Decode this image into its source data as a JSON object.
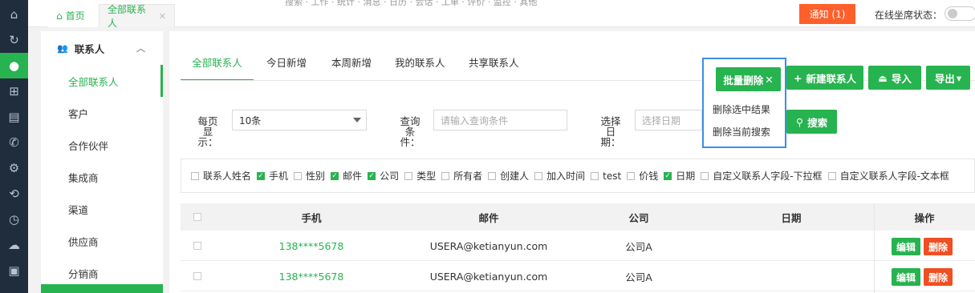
{
  "rail": {
    "icons": [
      {
        "name": "home-icon",
        "glyph": "⌂"
      },
      {
        "name": "refresh-icon",
        "glyph": "↻"
      },
      {
        "name": "user-icon",
        "glyph": "👤"
      },
      {
        "name": "apps-icon",
        "glyph": "⊞"
      },
      {
        "name": "clipboard-icon",
        "glyph": "📋"
      },
      {
        "name": "phone-icon",
        "glyph": "✆"
      },
      {
        "name": "settings-icon",
        "glyph": "⚙"
      },
      {
        "name": "history-icon",
        "glyph": "⟲"
      },
      {
        "name": "clock-icon",
        "glyph": "◷"
      },
      {
        "name": "chat-icon",
        "glyph": "☁"
      },
      {
        "name": "briefcase-icon",
        "glyph": "▣"
      }
    ]
  },
  "topbar": {
    "home_tab": "首页",
    "contacts_tab": "全部联系人",
    "notice_btn": "通知 (1)",
    "online_label": "在线坐席状态：",
    "ghost_text": "搜索  · 工作 · 统计 · 消息 · 日历 · 会话 · 工单 · 评价 · 监控 · 其他"
  },
  "sidebar": {
    "header": "联系人",
    "items": [
      "全部联系人",
      "客户",
      "合作伙伴",
      "集成商",
      "渠道",
      "供应商",
      "分销商"
    ]
  },
  "tabs": [
    "全部联系人",
    "今日新增",
    "本周新增",
    "我的联系人",
    "共享联系人"
  ],
  "actions": {
    "batch_delete": "批量删除",
    "new_contact": "新建联系人",
    "import": "导入",
    "export": "导出",
    "dropdown": [
      "删除选中结果",
      "删除当前搜索"
    ]
  },
  "filters": {
    "per_page_label": "每页显示：",
    "per_page_value": "10条",
    "query_label": "查询条件：",
    "query_placeholder": "请输入查询条件",
    "date_label": "选择日期：",
    "date_placeholder": "选择日期",
    "search_btn": "搜索"
  },
  "columns_panel": [
    {
      "label": "联系人姓名",
      "checked": false
    },
    {
      "label": "手机",
      "checked": true
    },
    {
      "label": "性别",
      "checked": false
    },
    {
      "label": "邮件",
      "checked": true
    },
    {
      "label": "公司",
      "checked": true
    },
    {
      "label": "类型",
      "checked": false
    },
    {
      "label": "所有者",
      "checked": false
    },
    {
      "label": "创建人",
      "checked": false
    },
    {
      "label": "加入时间",
      "checked": false
    },
    {
      "label": "test",
      "checked": false
    },
    {
      "label": "价钱",
      "checked": false
    },
    {
      "label": "日期",
      "checked": true
    },
    {
      "label": "自定义联系人字段-下拉框",
      "checked": false
    },
    {
      "label": "自定义联系人字段-文本框",
      "checked": false
    }
  ],
  "table": {
    "headers": {
      "phone": "手机",
      "email": "邮件",
      "company": "公司",
      "date": "日期",
      "ops": "操作"
    },
    "rows": [
      {
        "phone": "138****5678",
        "email": "USERA@ketianyun.com",
        "company": "公司A",
        "date": ""
      },
      {
        "phone": "138****5678",
        "email": "USERA@ketianyun.com",
        "company": "公司A",
        "date": ""
      }
    ],
    "edit_label": "编辑",
    "delete_label": "删除"
  },
  "colors": {
    "accent": "#27b34f",
    "danger": "#f04e23",
    "notice": "#ff5f2b",
    "highlight_border": "#3a8ee6",
    "rail_bg": "#1f2d3d"
  }
}
